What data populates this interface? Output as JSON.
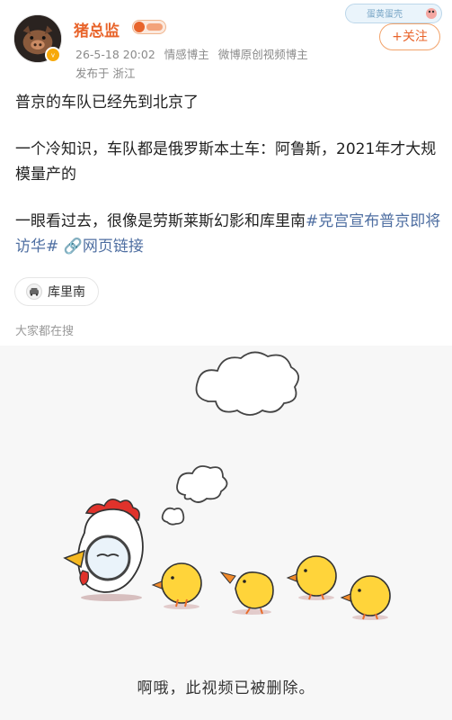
{
  "user": {
    "name": "猪总监",
    "date": "26-5-18 20:02",
    "tags": [
      "情感博主",
      "微博原创视频博主"
    ],
    "location": "发布于 浙江",
    "badge_text": "蛋黄蛋壳"
  },
  "follow_button": "+关注",
  "post": {
    "line1": "普京的车队已经先到北京了",
    "line2": "一个冷知识，车队都是俄罗斯本土车：阿鲁斯，2021年才大规模量产的",
    "line3_prefix": "一眼看过去，很像是劳斯莱斯幻影和库里南",
    "line3_hashtag": "#克宫宣布普京即将访华#",
    "line3_link": "网页链接"
  },
  "tag_chip": {
    "icon": "car-icon",
    "label": "库里南"
  },
  "search_hint": "大家都在搜",
  "video": {
    "deleted_message": "啊哦，此视频已被删除。"
  },
  "colors": {
    "username": "#e8642b",
    "link": "#4e6ea1",
    "follow_border": "#f2a36b",
    "video_bg": "#f7f7f7"
  }
}
